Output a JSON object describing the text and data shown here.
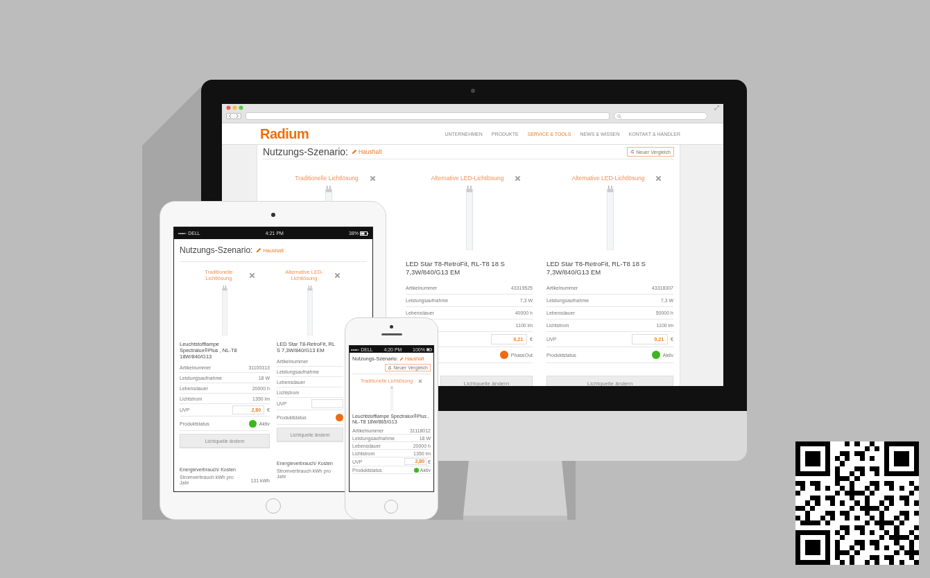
{
  "devices": [
    {
      "kind": "desktop",
      "header": {
        "logo": "Radium",
        "nav": [
          {
            "label": "UNTERNEHMEN",
            "selected": false
          },
          {
            "label": "PRODUKTE",
            "selected": false
          },
          {
            "label": "SERVICE & TOOLS",
            "selected": true
          },
          {
            "label": "NEWS & WISSEN",
            "selected": false
          },
          {
            "label": "KONTAKT & HÄNDLER",
            "selected": false
          }
        ]
      },
      "heading": "Nutzungs-Szenario:",
      "scenario": "Haushalt",
      "new_button": "Neuer Vergleich",
      "cards": [
        {
          "title": "Traditionelle Lichtlösung"
        },
        {
          "title": "Alternative LED-Lichtlösung",
          "product_lines": [
            "LED Star T8-RetroFit, RL-T8 18 S",
            "7,3W/840/G13 EM"
          ],
          "rows": [
            {
              "kind": "text",
              "label": "Artikelnummer",
              "value": "43319525"
            },
            {
              "kind": "text",
              "label": "Leistungsaufnahme",
              "value": "7,3 W"
            },
            {
              "kind": "text",
              "label": "Lebensdauer",
              "value": "40000 h"
            },
            {
              "kind": "text",
              "value": "1100 lm"
            },
            {
              "kind": "price",
              "value": "0,21",
              "unit": "€"
            },
            {
              "kind": "status",
              "value": "PhaseOut",
              "color": "#f06a10"
            }
          ],
          "button": "Lichtquelle ändern"
        },
        {
          "title": "Alternative LED-Lichtlösung",
          "product_lines": [
            "LED Star T8-RetroFit, RL-T8 18 S",
            "7,3W/840/G13 EM"
          ],
          "rows": [
            {
              "kind": "text",
              "label": "Artikelnummer",
              "value": "43318307"
            },
            {
              "kind": "text",
              "label": "Leistungsaufnahme",
              "value": "7,3 W"
            },
            {
              "kind": "text",
              "label": "Lebensdauer",
              "value": "50000 h"
            },
            {
              "kind": "text",
              "label": "Lichtstrom",
              "value": "1100 lm"
            },
            {
              "kind": "price",
              "label": "UVP",
              "value": "0,21",
              "unit": "€"
            },
            {
              "kind": "status",
              "label": "Produktstatus",
              "value": "Aktiv",
              "color": "#3cb81e"
            }
          ],
          "button": "Lichtquelle ändern"
        }
      ]
    },
    {
      "kind": "tablet",
      "status_bar": {
        "carrier": "••••◦ DELL",
        "time": "4:21 PM",
        "battery": "38%"
      },
      "heading": "Nutzungs-Szenario:",
      "scenario": "Haushalt",
      "cards": [
        {
          "title": "Traditionelle Lichtlösung",
          "product_lines": [
            "Leuchtstofflampe",
            "Spectralux®Plus , NL-T8",
            "18W/840/G13"
          ],
          "rows": [
            {
              "kind": "text",
              "label": "Artikelnummer",
              "value": "31100313"
            },
            {
              "kind": "text",
              "label": "Leistungsaufnahme",
              "value": "18 W"
            },
            {
              "kind": "text",
              "label": "Lebensdauer",
              "value": "20000 h"
            },
            {
              "kind": "text",
              "label": "Lichtstrom",
              "value": "1350 lm"
            },
            {
              "kind": "price",
              "label": "UVP",
              "value": "2,80",
              "unit": "€"
            },
            {
              "kind": "status",
              "label": "Produktstatus",
              "value": "Aktiv",
              "color": "#3cb81e"
            }
          ],
          "button": "Lichtquelle ändern",
          "energy": {
            "title": "Energieverbrauch/ Kosten",
            "rows": [
              {
                "label": "Stromverbrauch kWh pro Jahr",
                "value": "131 kWh"
              }
            ]
          }
        },
        {
          "title": "Alternative LED-Lichtlösung",
          "product_lines": [
            "LED Star T8-RetroFit, RL",
            "S 7,3W/840/G13 EM"
          ],
          "rows": [
            {
              "kind": "text",
              "label": "Artikelnummer"
            },
            {
              "kind": "text",
              "label": "Leistungsaufnahme"
            },
            {
              "kind": "text",
              "label": "Lebensdauer"
            },
            {
              "kind": "text",
              "label": "Lichtstrom"
            },
            {
              "kind": "price",
              "label": "UVP"
            },
            {
              "kind": "status",
              "label": "Produktstatus",
              "color": "#f06a10"
            }
          ],
          "button": "Lichtquelle ändern",
          "energy": {
            "title": "Energieverbrauch/ Kosten",
            "rows": [
              {
                "label": "Stromverbrauch kWh pro Jahr"
              }
            ]
          }
        }
      ]
    },
    {
      "kind": "phone",
      "status_bar": {
        "carrier": "••••◦ DELL",
        "time": "4:20 PM",
        "battery": "100%"
      },
      "heading": "Nutzungs-Szenario:",
      "scenario": "Haushalt",
      "new_button": "Neuer Vergleich",
      "cards": [
        {
          "title": "Traditionelle Lichtlösung",
          "product_lines": [
            "Leuchtstofflampe Spectralux®Plus ,",
            "NL-T8 18W/865/G13"
          ],
          "rows": [
            {
              "kind": "text",
              "label": "Artikelnummer",
              "value": "31118012"
            },
            {
              "kind": "text",
              "label": "Leistungsaufnahme",
              "value": "18 W"
            },
            {
              "kind": "text",
              "label": "Lebensdauer",
              "value": "20000 h"
            },
            {
              "kind": "text",
              "label": "Lichtstrom",
              "value": "1350 lm"
            },
            {
              "kind": "price",
              "label": "UVP",
              "value": "2,80",
              "unit": "€"
            },
            {
              "kind": "status",
              "label": "Produktstatus",
              "value": "Aktiv",
              "color": "#3cb81e"
            }
          ]
        }
      ]
    }
  ]
}
